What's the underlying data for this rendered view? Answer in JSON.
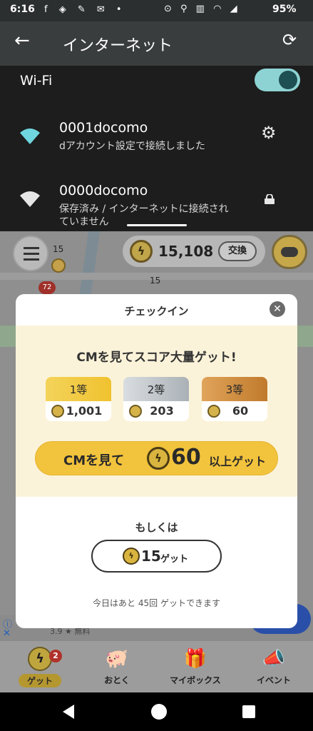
{
  "statusbar": {
    "time": "6:16",
    "left_icons": "f ◈ ✎ ✉ •",
    "right_icons": "⊙ ⚲ ▥ ◠ ◢",
    "battery": "95%"
  },
  "internet": {
    "title": "インターネット",
    "back_icon": "arrow-left-icon",
    "refresh_icon": "refresh-icon",
    "wifi_label": "Wi-Fi",
    "wifi_on": true,
    "networks": [
      {
        "ssid": "0001docomo",
        "subtitle": "dアカウント設定で接続しました",
        "icon": "gear-icon"
      },
      {
        "ssid": "0000docomo",
        "subtitle": "保存済み / インターネットに接続されていません",
        "icon": "lock-icon"
      }
    ]
  },
  "map": {
    "pin_numbers": [
      "15",
      "15"
    ],
    "badge": "72",
    "score": "15,108",
    "exchange_label": "交換"
  },
  "modal": {
    "title": "チェックイン",
    "headline": "CMを見てスコア大量ゲット!",
    "prizes": [
      {
        "rank": "1等",
        "value": "1,001"
      },
      {
        "rank": "2等",
        "value": "203"
      },
      {
        "rank": "3等",
        "value": "60"
      }
    ],
    "cm_button": {
      "prefix": "CMを見て",
      "amount": "60",
      "suffix": "以上ゲット"
    },
    "or_text": "もしくは",
    "get_button": {
      "amount": "15",
      "label": "ゲット"
    },
    "remaining_text": "今日はあと 45回 ゲットできます"
  },
  "ad": {
    "rating": "3.9 ★ 無料"
  },
  "bottomnav": {
    "items": [
      {
        "label": "ゲット",
        "badge": "2"
      },
      {
        "label": "おとく"
      },
      {
        "label": "マイボックス"
      },
      {
        "label": "イベント"
      }
    ]
  },
  "colors": {
    "accent": "#f2c33c",
    "panel_bg": "#1d1d1d",
    "modal_cream": "#fbf3d9"
  }
}
